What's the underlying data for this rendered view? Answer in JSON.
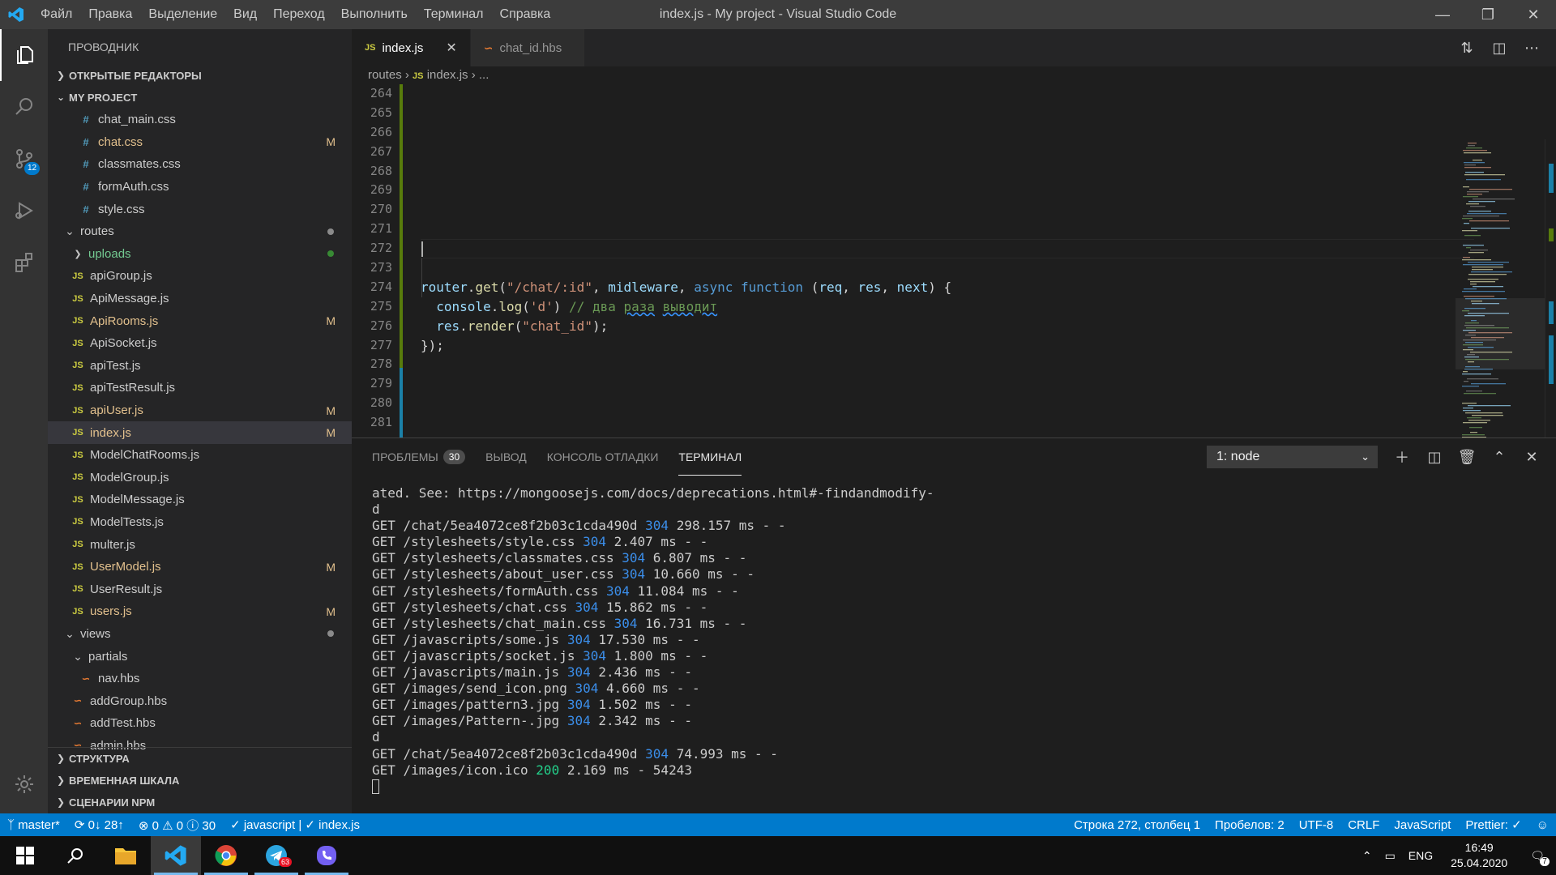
{
  "window": {
    "title": "index.js - My project - Visual Studio Code",
    "menu": [
      "Файл",
      "Правка",
      "Выделение",
      "Вид",
      "Переход",
      "Выполнить",
      "Терминал",
      "Справка"
    ]
  },
  "activity": {
    "scm_badge": "12"
  },
  "sidebar": {
    "title": "ПРОВОДНИК",
    "open_editors": "ОТКРЫТЫЕ РЕДАКТОРЫ",
    "project": "MY PROJECT",
    "tree": [
      {
        "name": "chat_main.css",
        "type": "css",
        "level": 3,
        "status": ""
      },
      {
        "name": "chat.css",
        "type": "css",
        "level": 3,
        "status": "M"
      },
      {
        "name": "classmates.css",
        "type": "css",
        "level": 3,
        "status": ""
      },
      {
        "name": "formAuth.css",
        "type": "css",
        "level": 3,
        "status": ""
      },
      {
        "name": "style.css",
        "type": "css",
        "level": 3,
        "status": ""
      },
      {
        "name": "routes",
        "type": "folder-open",
        "level": 1,
        "status": "dot"
      },
      {
        "name": "uploads",
        "type": "folder",
        "level": 2,
        "status": "dot-green"
      },
      {
        "name": "apiGroup.js",
        "type": "js",
        "level": 2,
        "status": ""
      },
      {
        "name": "ApiMessage.js",
        "type": "js",
        "level": 2,
        "status": ""
      },
      {
        "name": "ApiRooms.js",
        "type": "js",
        "level": 2,
        "status": "M"
      },
      {
        "name": "ApiSocket.js",
        "type": "js",
        "level": 2,
        "status": ""
      },
      {
        "name": "apiTest.js",
        "type": "js",
        "level": 2,
        "status": ""
      },
      {
        "name": "apiTestResult.js",
        "type": "js",
        "level": 2,
        "status": ""
      },
      {
        "name": "apiUser.js",
        "type": "js",
        "level": 2,
        "status": "M"
      },
      {
        "name": "index.js",
        "type": "js",
        "level": 2,
        "status": "M",
        "selected": true
      },
      {
        "name": "ModelChatRooms.js",
        "type": "js",
        "level": 2,
        "status": ""
      },
      {
        "name": "ModelGroup.js",
        "type": "js",
        "level": 2,
        "status": ""
      },
      {
        "name": "ModelMessage.js",
        "type": "js",
        "level": 2,
        "status": ""
      },
      {
        "name": "ModelTests.js",
        "type": "js",
        "level": 2,
        "status": ""
      },
      {
        "name": "multer.js",
        "type": "js",
        "level": 2,
        "status": ""
      },
      {
        "name": "UserModel.js",
        "type": "js",
        "level": 2,
        "status": "M"
      },
      {
        "name": "UserResult.js",
        "type": "js",
        "level": 2,
        "status": ""
      },
      {
        "name": "users.js",
        "type": "js",
        "level": 2,
        "status": "M"
      },
      {
        "name": "views",
        "type": "folder-open",
        "level": 1,
        "status": "dot"
      },
      {
        "name": "partials",
        "type": "folder-open",
        "level": 2,
        "status": ""
      },
      {
        "name": "nav.hbs",
        "type": "hbs",
        "level": 3,
        "status": ""
      },
      {
        "name": "addGroup.hbs",
        "type": "hbs",
        "level": 2,
        "status": ""
      },
      {
        "name": "addTest.hbs",
        "type": "hbs",
        "level": 2,
        "status": ""
      },
      {
        "name": "admin.hbs",
        "type": "hbs",
        "level": 2,
        "status": ""
      }
    ],
    "bottom_sections": [
      "СТРУКТУРА",
      "ВРЕМЕННАЯ ШКАЛА",
      "СЦЕНАРИИ NPM"
    ]
  },
  "tabs": [
    {
      "label": "index.js",
      "icon": "JS",
      "active": true
    },
    {
      "label": "chat_id.hbs",
      "icon": "hbs",
      "active": false
    }
  ],
  "breadcrumbs": {
    "folder": "routes",
    "file": "index.js",
    "tail": "..."
  },
  "editor": {
    "line_numbers": [
      "264",
      "265",
      "266",
      "267",
      "268",
      "269",
      "270",
      "271",
      "272",
      "273",
      "274",
      "275",
      "276",
      "277",
      "278",
      "279",
      "280",
      "281"
    ]
  },
  "code": {
    "l274": {
      "a": "router",
      "b": ".",
      "c": "get",
      "d": "(",
      "e": "\"/chat/:id\"",
      "f": ", ",
      "g": "midleware",
      "h": ", ",
      "i": "async",
      "j": " ",
      "k": "function",
      "l": " (",
      "m": "req",
      "n": ", ",
      "o": "res",
      "p": ", ",
      "q": "next",
      "r": ") {"
    },
    "l275": {
      "a": "  console",
      "b": ".",
      "c": "log",
      "d": "(",
      "e": "'d'",
      "f": ") ",
      "g": "// два ",
      "h": "раза",
      "i": " ",
      "j": "выводит"
    },
    "l276": {
      "a": "  res",
      "b": ".",
      "c": "render",
      "d": "(",
      "e": "\"chat_id\"",
      "f": ");"
    },
    "l277": "});"
  },
  "panel": {
    "tabs": {
      "problems": "ПРОБЛЕМЫ",
      "problems_count": "30",
      "output": "ВЫВОД",
      "debug": "КОНСОЛЬ ОТЛАДКИ",
      "terminal": "ТЕРМИНАЛ"
    },
    "terminal_select": "1: node"
  },
  "terminal": [
    {
      "text": "ated. See: https://mongoosejs.com/docs/deprecations.html#-findandmodify-"
    },
    {
      "text": "d"
    },
    {
      "pre": "GET /chat/5ea4072ce8f2b03c1cda490d ",
      "code": "304",
      "post": " 298.157 ms - -",
      "color": "blue"
    },
    {
      "pre": "GET /stylesheets/style.css ",
      "code": "304",
      "post": " 2.407 ms - -",
      "color": "blue"
    },
    {
      "pre": "GET /stylesheets/classmates.css ",
      "code": "304",
      "post": " 6.807 ms - -",
      "color": "blue"
    },
    {
      "pre": "GET /stylesheets/about_user.css ",
      "code": "304",
      "post": " 10.660 ms - -",
      "color": "blue"
    },
    {
      "pre": "GET /stylesheets/formAuth.css ",
      "code": "304",
      "post": " 11.084 ms - -",
      "color": "blue"
    },
    {
      "pre": "GET /stylesheets/chat.css ",
      "code": "304",
      "post": " 15.862 ms - -",
      "color": "blue"
    },
    {
      "pre": "GET /stylesheets/chat_main.css ",
      "code": "304",
      "post": " 16.731 ms - -",
      "color": "blue"
    },
    {
      "pre": "GET /javascripts/some.js ",
      "code": "304",
      "post": " 17.530 ms - -",
      "color": "blue"
    },
    {
      "pre": "GET /javascripts/socket.js ",
      "code": "304",
      "post": " 1.800 ms - -",
      "color": "blue"
    },
    {
      "pre": "GET /javascripts/main.js ",
      "code": "304",
      "post": " 2.436 ms - -",
      "color": "blue"
    },
    {
      "pre": "GET /images/send_icon.png ",
      "code": "304",
      "post": " 4.660 ms - -",
      "color": "blue"
    },
    {
      "pre": "GET /images/pattern3.jpg ",
      "code": "304",
      "post": " 1.502 ms - -",
      "color": "blue"
    },
    {
      "pre": "GET /images/Pattern-.jpg ",
      "code": "304",
      "post": " 2.342 ms - -",
      "color": "blue"
    },
    {
      "text": "d"
    },
    {
      "pre": "GET /chat/5ea4072ce8f2b03c1cda490d ",
      "code": "304",
      "post": " 74.993 ms - -",
      "color": "blue"
    },
    {
      "pre": "GET /images/icon.ico ",
      "code": "200",
      "post": " 2.169 ms - 54243",
      "color": "green"
    }
  ],
  "status": {
    "branch": "master*",
    "sync": "0↓ 28↑",
    "errors": "0",
    "warnings": "0",
    "info": "30",
    "lint": "javascript | ✓ index.js",
    "position": "Строка 272, столбец 1",
    "spaces": "Пробелов: 2",
    "encoding": "UTF-8",
    "eol": "CRLF",
    "language": "JavaScript",
    "prettier": "Prettier: ✓"
  },
  "taskbar": {
    "telegram_badge": "63",
    "lang": "ENG",
    "time": "16:49",
    "date": "25.04.2020",
    "notif_count": "7"
  },
  "colors": {
    "accent": "#007acc",
    "sidebar": "#252526",
    "editor": "#1e1e1e"
  }
}
